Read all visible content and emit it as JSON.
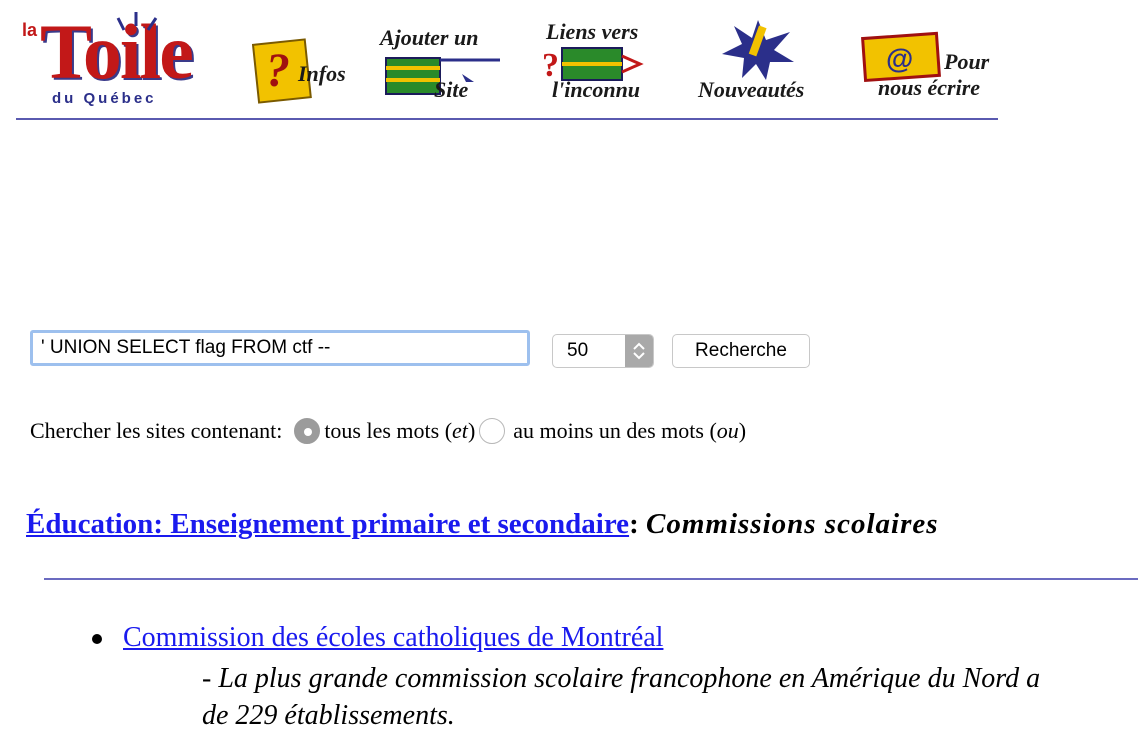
{
  "header": {
    "logo": {
      "line1": "la",
      "line2": "Toile",
      "line3": "du Québec"
    },
    "nav": [
      {
        "id": "infos",
        "label": "Infos"
      },
      {
        "id": "ajouter",
        "label_line1": "Ajouter un",
        "label_line2": "Site"
      },
      {
        "id": "liens",
        "label_line1": "Liens vers",
        "label_line2": "l'inconnu"
      },
      {
        "id": "nouveautes",
        "label": "Nouveautés"
      },
      {
        "id": "ecrire",
        "label_line1": "Pour",
        "label_line2": "nous écrire"
      }
    ]
  },
  "search": {
    "query": "' UNION SELECT flag FROM ctf --",
    "count_selected": "50",
    "button_label": "Recherche",
    "mode_label": "Chercher les sites contenant:",
    "mode_all_label": "tous les mots ",
    "mode_all_op": "et",
    "mode_any_label": "au moins un des mots ",
    "mode_any_op": "ou",
    "mode_selected": "all"
  },
  "category": {
    "link": "Éducation: Enseignement primaire et secondaire",
    "separator": ":",
    "title": "Commissions scolaires"
  },
  "results": [
    {
      "title": "Commission des écoles catholiques de Montréal",
      "description": "- La plus grande commission scolaire francophone en Amérique du Nord a",
      "description_line2": "de 229 établissements."
    }
  ],
  "colors": {
    "link": "#1a1aee",
    "logo_red": "#c21818",
    "logo_blue": "#2b2f8a",
    "rule": "#5a5ab0"
  }
}
